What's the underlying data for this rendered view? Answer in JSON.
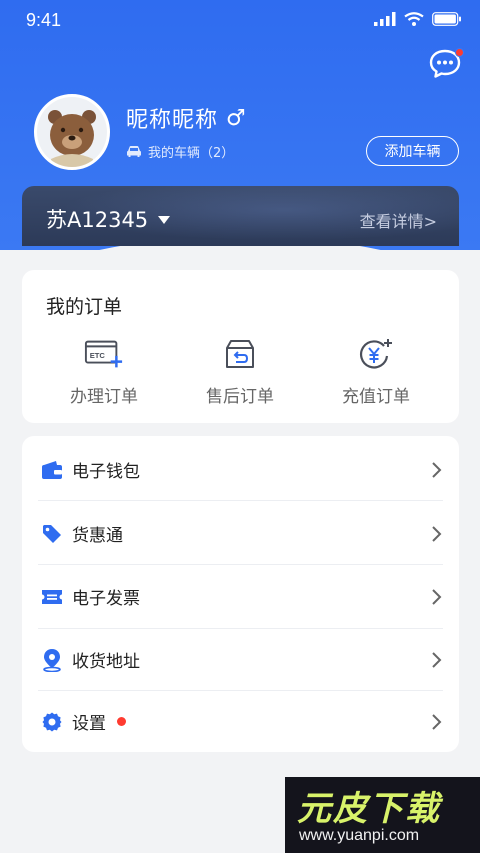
{
  "status_bar": {
    "time": "9:41"
  },
  "profile": {
    "nickname": "昵称昵称",
    "gender_symbol": "♂",
    "my_vehicles_label": "我的车辆（2）",
    "add_vehicle_label": "添加车辆"
  },
  "plate": {
    "number": "苏A12345",
    "detail_link": "查看详情>"
  },
  "orders": {
    "title": "我的订单",
    "items": [
      {
        "label": "办理订单",
        "icon": "etc-card-add-icon"
      },
      {
        "label": "售后订单",
        "icon": "return-box-icon"
      },
      {
        "label": "充值订单",
        "icon": "yen-recharge-icon"
      }
    ]
  },
  "menu": {
    "items": [
      {
        "label": "电子钱包",
        "icon": "wallet-icon"
      },
      {
        "label": "货惠通",
        "icon": "tag-icon"
      },
      {
        "label": "电子发票",
        "icon": "ticket-icon"
      },
      {
        "label": "收货地址",
        "icon": "location-pin-icon"
      },
      {
        "label": "设置",
        "icon": "gear-icon",
        "badge_dot": true
      }
    ]
  },
  "watermark": {
    "title": "元皮下载",
    "url": "www.yuanpi.com"
  },
  "colors": {
    "primary": "#2f6cf0",
    "plate_card": "#344361",
    "badge": "#ff3b30",
    "menu_icon": "#2f6cf0"
  }
}
